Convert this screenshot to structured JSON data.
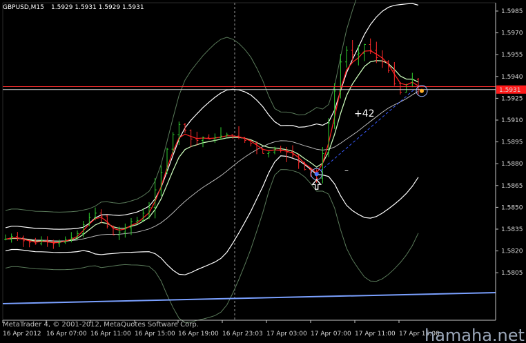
{
  "header": {
    "symbol_timeframe": "GBPUSD,M15",
    "ohlc": "1.5929 1.5931 1.5929 1.5931"
  },
  "footer": {
    "copyright": "MetaTrader 4, © 2001-2012, MetaQuotes Software Corp.",
    "watermark": "hamaha.net"
  },
  "annotations": {
    "profit_label": "+42",
    "minus_label": "–"
  },
  "current_price": "1.5931",
  "colors": {
    "background": "#000000",
    "axis": "#c8c8c8",
    "bull_bar": "#2fd12f",
    "bear_bar": "#ff2a2a",
    "ma_red": "#ff2020",
    "ma_lightgreen": "#c8f8b8",
    "ma_white": "#ffffff",
    "bollinger": "#5a7a5a",
    "hline_red": "#ff3030",
    "trendline": "#7aa0ff",
    "price_tag": "#ff1a1a"
  },
  "chart_data": {
    "type": "candlestick",
    "symbol": "GBPUSD",
    "timeframe": "M15",
    "y_axis_ticks": [
      "1.5985",
      "1.5970",
      "1.5955",
      "1.5940",
      "1.5925",
      "1.5910",
      "1.5895",
      "1.5880",
      "1.5865",
      "1.5850",
      "1.5835",
      "1.5820",
      "1.5805"
    ],
    "ylim": [
      1.58,
      1.599
    ],
    "x_axis_ticks": [
      "16 Apr 2012",
      "16 Apr 07:00",
      "16 Apr 11:00",
      "16 Apr 15:00",
      "16 Apr 19:00",
      "16 Apr 23:03",
      "17 Apr 03:00",
      "17 Apr 07:00",
      "17 Apr 11:00",
      "17 Apr 15:00"
    ],
    "close_series": [
      1.5828,
      1.583,
      1.5829,
      1.5827,
      1.5826,
      1.5825,
      1.5827,
      1.5826,
      1.5825,
      1.5826,
      1.5828,
      1.5829,
      1.5832,
      1.5838,
      1.5843,
      1.5846,
      1.5844,
      1.5837,
      1.5831,
      1.5833,
      1.5836,
      1.584,
      1.5841,
      1.5846,
      1.585,
      1.5862,
      1.5874,
      1.589,
      1.59,
      1.5907,
      1.5903,
      1.5897,
      1.5896,
      1.5898,
      1.5897,
      1.5898,
      1.5899,
      1.59,
      1.5899,
      1.5898,
      1.5896,
      1.5894,
      1.589,
      1.5887,
      1.5888,
      1.589,
      1.5889,
      1.5888,
      1.5886,
      1.5881,
      1.5876,
      1.5874,
      1.587,
      1.5887,
      1.5908,
      1.593,
      1.595,
      1.5958,
      1.5955,
      1.5956,
      1.5962,
      1.5958,
      1.5953,
      1.595,
      1.5944,
      1.5935,
      1.5929,
      1.5933,
      1.5938,
      1.5931
    ],
    "horizontal_levels": [
      1.5933,
      1.5931
    ],
    "price_label": "1.5931",
    "trendline": {
      "from": [
        0,
        1.5815
      ],
      "to": [
        1,
        1.5821
      ]
    },
    "current_price": 1.5931,
    "profit_annotation": "+42"
  }
}
